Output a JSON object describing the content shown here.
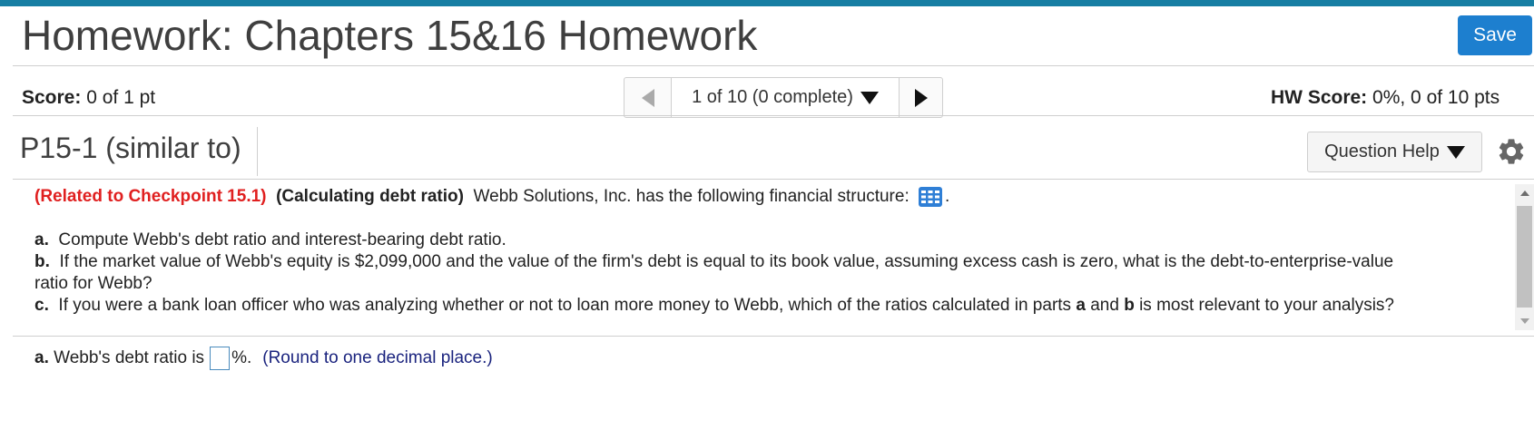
{
  "header": {
    "title": "Homework: Chapters 15&16 Homework",
    "save_label": "Save"
  },
  "score": {
    "label": "Score:",
    "value": "0 of 1 pt"
  },
  "navigation": {
    "position": "1 of 10 (0 complete)"
  },
  "hw_score": {
    "label": "HW Score:",
    "value": "0%, 0 of 10 pts"
  },
  "question": {
    "title": "P15-1 (similar to)",
    "help_label": "Question Help",
    "related": "(Related to Checkpoint 15.1)",
    "topic": "(Calculating debt ratio)",
    "intro": "Webb Solutions, Inc. has the following financial structure:",
    "intro_end": ".",
    "part_a_label": "a.",
    "part_a_text": "Compute Webb's debt ratio and interest-bearing debt ratio.",
    "part_b_label": "b.",
    "part_b_text": "If the market value of Webb's equity is $2,099,000 and the value of the firm's debt is equal to its book value, assuming excess cash is zero, what is the debt-to-enterprise-value ratio for Webb?",
    "part_c_label": "c.",
    "part_c_text_1": "If you were a bank loan officer who was analyzing whether or not to loan more money to Webb, which of the ratios calculated in parts",
    "part_c_bold_a": "a",
    "part_c_and": "and",
    "part_c_bold_b": "b",
    "part_c_text_2": "is most relevant to your analysis?"
  },
  "answer": {
    "label": "a.",
    "prefix": "Webb's debt ratio is",
    "input_value": "",
    "suffix": "%.",
    "hint": "(Round to one decimal place.)"
  },
  "icons": {
    "table": "table-grid-icon",
    "settings": "gear-icon"
  },
  "colors": {
    "accent_bar": "#177ea3",
    "save_button": "#1d7fcf",
    "related_red": "#e02020",
    "hint_blue": "#1a237e"
  }
}
